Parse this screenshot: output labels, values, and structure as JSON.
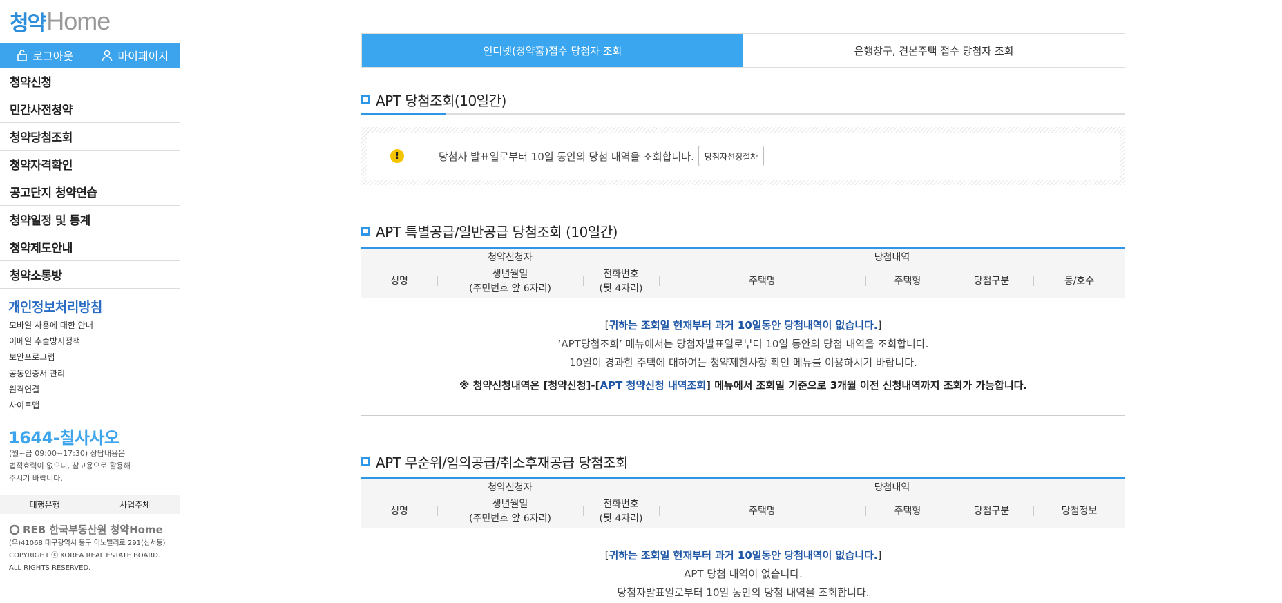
{
  "sidebar": {
    "logo_korean": "청약",
    "logo_home": "Home",
    "logout": "로그아웃",
    "mypage": "마이페이지",
    "menu": [
      "청약신청",
      "민간사전청약",
      "청약당첨조회",
      "청약자격확인",
      "공고단지 청약연습",
      "청약일정 및 통계",
      "청약제도안내",
      "청약소통방"
    ],
    "privacy": "개인정보처리방침",
    "links": [
      "모바일 사용에 대한 안내",
      "이메일 추출방지정책",
      "보안프로그램",
      "공동인증서 관리",
      "원격연결",
      "사이트맵"
    ],
    "phone_prefix": "1644-",
    "phone_word": "칠사사오",
    "phone_note1": "(월~금 09:00~17:30) 상담내용은",
    "phone_note2": "법적효력이 없으니, 참고용으로 활용해",
    "phone_note3": "주시기 바랍니다.",
    "bank": "대행은행",
    "business": "사업주체",
    "footer_org": "REB 한국부동산원 청약Home",
    "footer_addr1": "(우)41068 대구광역시 동구 이노밸리로 291(신서동)",
    "footer_addr2": "COPYRIGHT ⓒ KOREA REAL ESTATE BOARD.",
    "footer_addr3": "ALL RIGHTS RESERVED."
  },
  "tabs": {
    "internet": "인터넷(청약홈)접수 당첨자 조회",
    "bank": "은행창구, 견본주택 접수 당첨자 조회"
  },
  "section1": {
    "title": "APT 당첨조회(10일간)",
    "notice": "당첨자 발표일로부터 10일 동안의 당첨 내역을 조회합니다.",
    "button": "당첨자선정절차"
  },
  "section2": {
    "title": "APT 특별공급/일반공급 당첨조회 (10일간)",
    "group1": "청약신청자",
    "group2": "당첨내역",
    "cols": [
      "성명",
      "생년월일",
      "(주민번호 앞 6자리)",
      "전화번호",
      "(뒷 4자리)",
      "주택명",
      "주택형",
      "당첨구분",
      "동/호수"
    ],
    "empty_bracket_open": "[",
    "empty_msg": "귀하는 조회일 현재부터 과거 10일동안 당첨내역이 없습니다.",
    "empty_bracket_close": "]",
    "line2": "‘APT당첨조회’ 메뉴에서는 당첨자발표일로부터 10일 동안의 당첨 내역을 조회합니다.",
    "line3": "10일이 경과한 주택에 대하여는 청약제한사항 확인 메뉴를 이용하시기 바랍니다.",
    "note_prefix": "※ 청약신청내역은 [청약신청]-[",
    "note_link": "APT 청약신청 내역조회",
    "note_suffix": "] 메뉴에서 조회일 기준으로 3개월 이전 신청내역까지 조회가 가능합니다."
  },
  "section3": {
    "title": "APT 무순위/임의공급/취소후재공급 당첨조회",
    "group1": "청약신청자",
    "group2": "당첨내역",
    "cols": [
      "성명",
      "생년월일",
      "(주민번호 앞 6자리)",
      "전화번호",
      "(뒷 4자리)",
      "주택명",
      "주택형",
      "당첨구분",
      "당첨정보"
    ],
    "empty_bracket_open": "[",
    "empty_msg": "귀하는 조회일 현재부터 과거 10일동안 당첨내역이 없습니다.",
    "empty_bracket_close": "]",
    "line2": "APT 당첨 내역이 없습니다.",
    "line3": "당첨자발표일로부터 10일 동안의 당첨 내역을 조회합니다."
  }
}
